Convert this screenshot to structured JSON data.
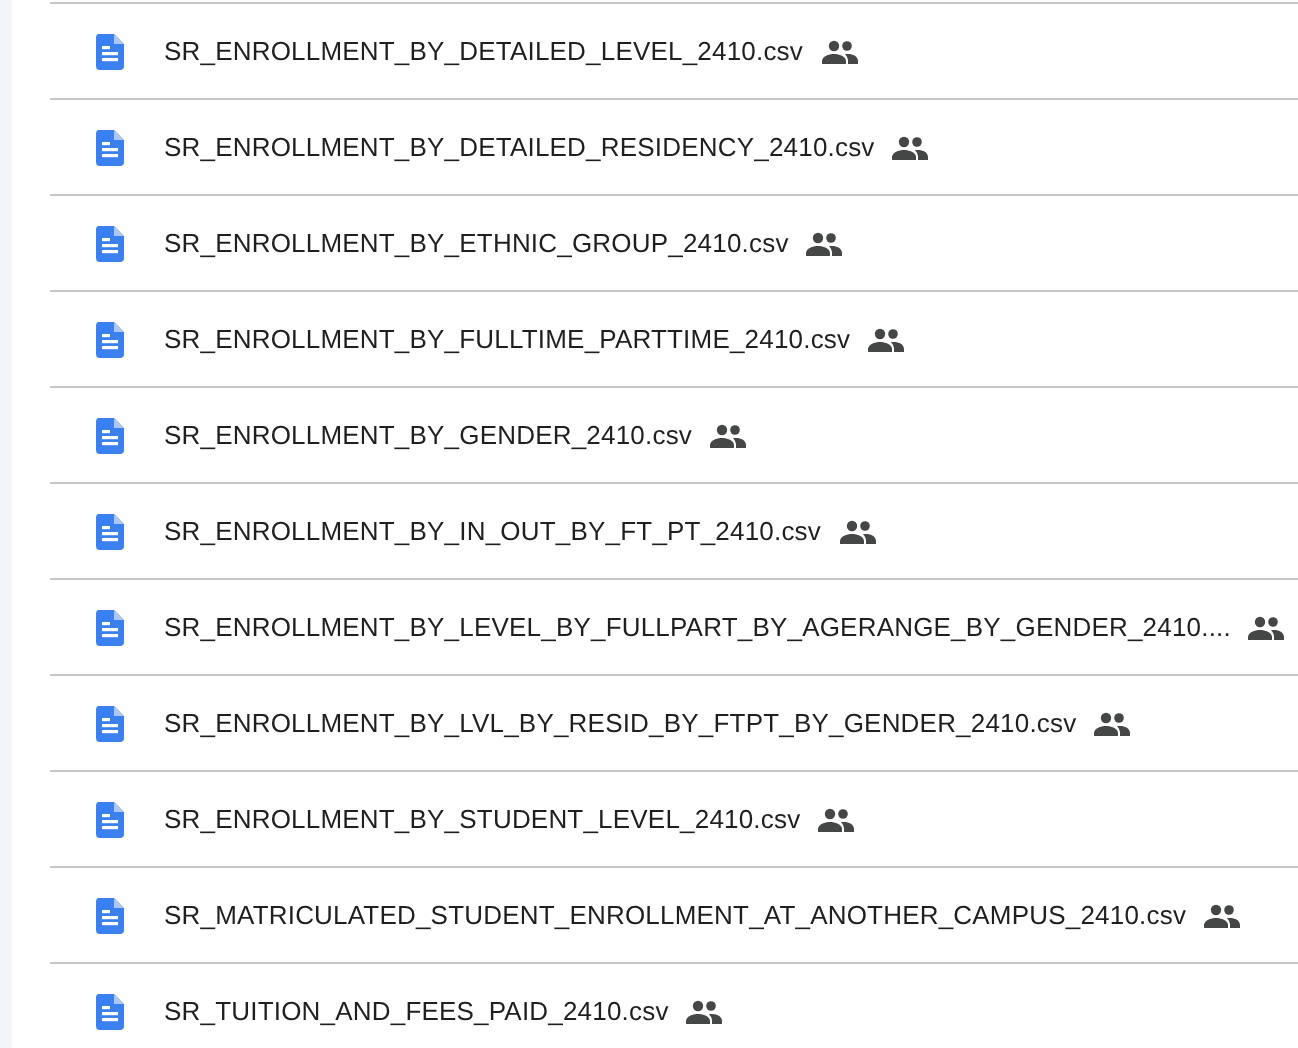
{
  "files": [
    {
      "name": "SR_ENROLLMENT_BY_DETAILED_LEVEL_2410.csv",
      "shared": true
    },
    {
      "name": "SR_ENROLLMENT_BY_DETAILED_RESIDENCY_2410.csv",
      "shared": true
    },
    {
      "name": "SR_ENROLLMENT_BY_ETHNIC_GROUP_2410.csv",
      "shared": true
    },
    {
      "name": "SR_ENROLLMENT_BY_FULLTIME_PARTTIME_2410.csv",
      "shared": true
    },
    {
      "name": "SR_ENROLLMENT_BY_GENDER_2410.csv",
      "shared": true
    },
    {
      "name": "SR_ENROLLMENT_BY_IN_OUT_BY_FT_PT_2410.csv",
      "shared": true
    },
    {
      "name": "SR_ENROLLMENT_BY_LEVEL_BY_FULLPART_BY_AGERANGE_BY_GENDER_2410....",
      "shared": true
    },
    {
      "name": "SR_ENROLLMENT_BY_LVL_BY_RESID_BY_FTPT_BY_GENDER_2410.csv",
      "shared": true
    },
    {
      "name": "SR_ENROLLMENT_BY_STUDENT_LEVEL_2410.csv",
      "shared": true
    },
    {
      "name": "SR_MATRICULATED_STUDENT_ENROLLMENT_AT_ANOTHER_CAMPUS_2410.csv",
      "shared": true
    },
    {
      "name": "SR_TUITION_AND_FEES_PAID_2410.csv",
      "shared": true
    }
  ]
}
